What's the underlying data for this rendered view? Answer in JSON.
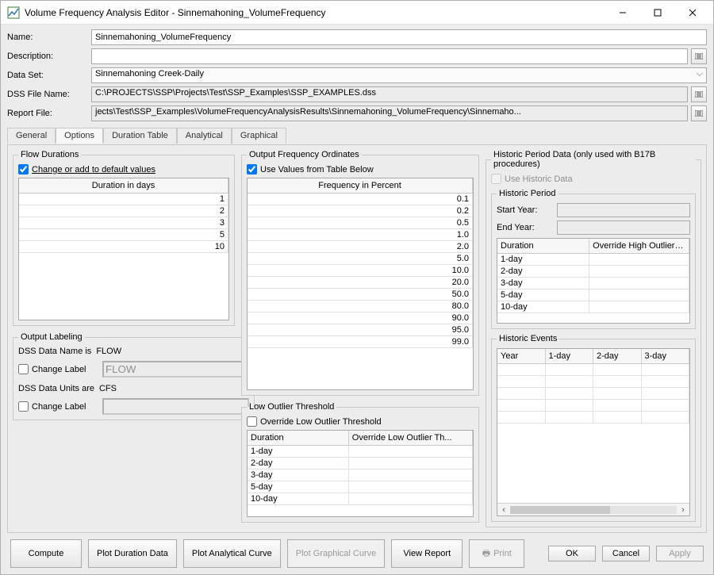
{
  "window": {
    "title": "Volume Frequency Analysis Editor - Sinnemahoning_VolumeFrequency"
  },
  "form": {
    "name_label": "Name:",
    "name_value": "Sinnemahoning_VolumeFrequency",
    "desc_label": "Description:",
    "desc_value": "",
    "dataset_label": "Data Set:",
    "dataset_value": "Sinnemahoning Creek-Daily",
    "dssfile_label": "DSS File Name:",
    "dssfile_value": "C:\\PROJECTS\\SSP\\Projects\\Test\\SSP_Examples\\SSP_EXAMPLES.dss",
    "report_label": "Report File:",
    "report_value": "jects\\Test\\SSP_Examples\\VolumeFrequencyAnalysisResults\\Sinnemahoning_VolumeFrequency\\Sinnemaho..."
  },
  "tabs": {
    "general": "General",
    "options": "Options",
    "duration_table": "Duration Table",
    "analytical": "Analytical",
    "graphical": "Graphical"
  },
  "flow_durations": {
    "title": "Flow Durations",
    "change_label": "Change or add to default values",
    "col_header": "Duration in days",
    "values": [
      "1",
      "2",
      "3",
      "5",
      "10"
    ]
  },
  "output_labeling": {
    "title": "Output Labeling",
    "dss_name_is": "DSS Data Name is",
    "dss_name_val": "FLOW",
    "change_label": "Change Label",
    "dss_name_field": "FLOW",
    "dss_units_are": "DSS Data Units are",
    "dss_units_val": "CFS",
    "dss_units_field": ""
  },
  "output_freq": {
    "title": "Output Frequency Ordinates",
    "use_values": "Use Values from Table Below",
    "col_header": "Frequency in Percent",
    "values": [
      "0.1",
      "0.2",
      "0.5",
      "1.0",
      "2.0",
      "5.0",
      "10.0",
      "20.0",
      "50.0",
      "80.0",
      "90.0",
      "95.0",
      "99.0"
    ]
  },
  "low_outlier": {
    "title": "Low Outlier Threshold",
    "override_label": "Override Low Outlier Threshold",
    "col_duration": "Duration",
    "col_override": "Override Low Outlier Th...",
    "rows": [
      "1-day",
      "2-day",
      "3-day",
      "5-day",
      "10-day"
    ]
  },
  "historic": {
    "title": "Historic Period Data (only used with B17B procedures)",
    "use_label": "Use Historic Data",
    "period_title": "Historic Period",
    "start_label": "Start Year:",
    "end_label": "End Year:",
    "col_duration": "Duration",
    "col_override": "Override High Outlier Thr...",
    "rows": [
      "1-day",
      "2-day",
      "3-day",
      "5-day",
      "10-day"
    ],
    "events_title": "Historic Events",
    "events_cols": [
      "Year",
      "1-day",
      "2-day",
      "3-day"
    ]
  },
  "buttons": {
    "compute": "Compute",
    "plot_duration": "Plot Duration Data",
    "plot_analytical": "Plot Analytical Curve",
    "plot_graphical": "Plot Graphical Curve",
    "view_report": "View Report",
    "print": "Print",
    "ok": "OK",
    "cancel": "Cancel",
    "apply": "Apply"
  }
}
